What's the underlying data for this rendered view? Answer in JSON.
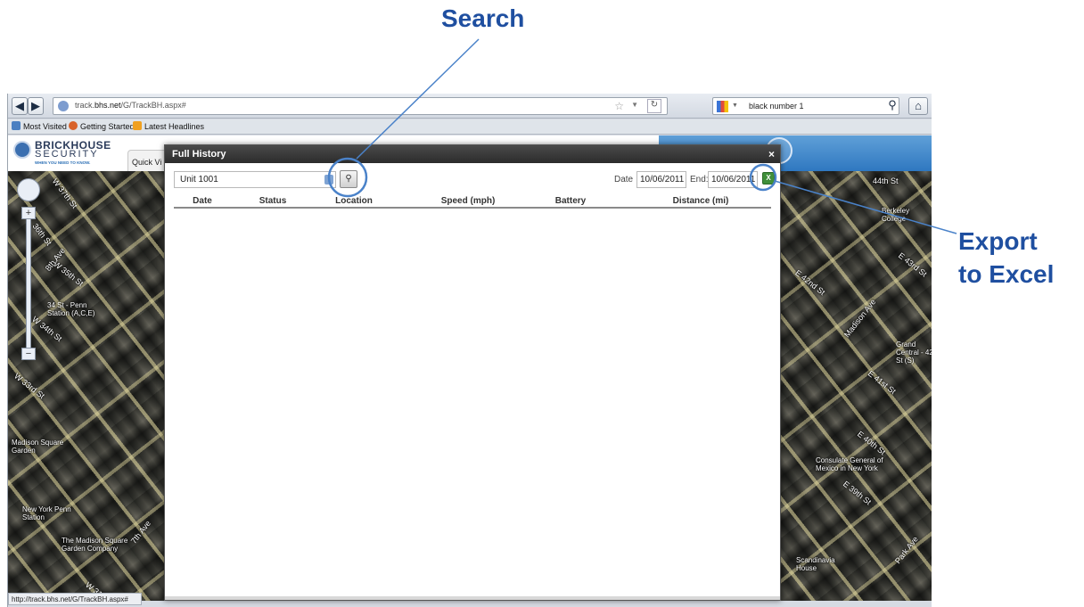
{
  "annotations": {
    "search": "Search",
    "export_line1": "Export",
    "export_line2": "to Excel"
  },
  "browser": {
    "url_prefix": "track.",
    "url_domain": "bhs.net",
    "url_path": "/G/TrackBH.aspx#",
    "search_text": "black number 1",
    "back_icon": "back-arrow-icon",
    "forward_icon": "forward-arrow-icon",
    "home_icon": "home-icon",
    "bookmarks": [
      {
        "label": "Most Visited",
        "color": "#4a7fc1"
      },
      {
        "label": "Getting Started",
        "color": "#d8622a"
      },
      {
        "label": "Latest Headlines",
        "color": "#f0a020"
      }
    ],
    "status_url": "http://track.bhs.net/G/TrackBH.aspx#"
  },
  "site": {
    "logo_main": "BRICKHOUSE",
    "logo_sub": "SECURITY",
    "logo_tagline": "WHEN YOU NEED TO KNOW.",
    "quick_tab": "Quick Vi"
  },
  "map": {
    "labels": [
      "W 37th St",
      "36th St",
      "W 35th St",
      "34 St - Penn Station (A,C,E)",
      "W 34th St",
      "W 33rd St",
      "Madison Square Garden",
      "New York Penn Station",
      "The Madison Square Garden Company",
      "8th Ave",
      "7th Ave",
      "W 31st St",
      "44th St",
      "Berkeley College",
      "E 43rd St",
      "E 42nd St",
      "Madison Ave",
      "Grand Central - 42 St (S)",
      "E 41st St",
      "E 40th St",
      "Consulate General of Mexico in New York",
      "E 39th St",
      "Scandinavia House",
      "Park Ave"
    ]
  },
  "modal": {
    "title": "Full History",
    "unit": "Unit 1001",
    "date_label": "Date",
    "start_date": "10/06/2011",
    "end_label": "End:",
    "end_date": "10/06/2011",
    "close": "×",
    "columns": [
      "Date",
      "Status",
      "Location",
      "Speed (mph)",
      "Battery",
      "Distance (mi)"
    ]
  },
  "colors": {
    "annotation": "#1f4fa0",
    "excel": "#3f8f3a"
  }
}
